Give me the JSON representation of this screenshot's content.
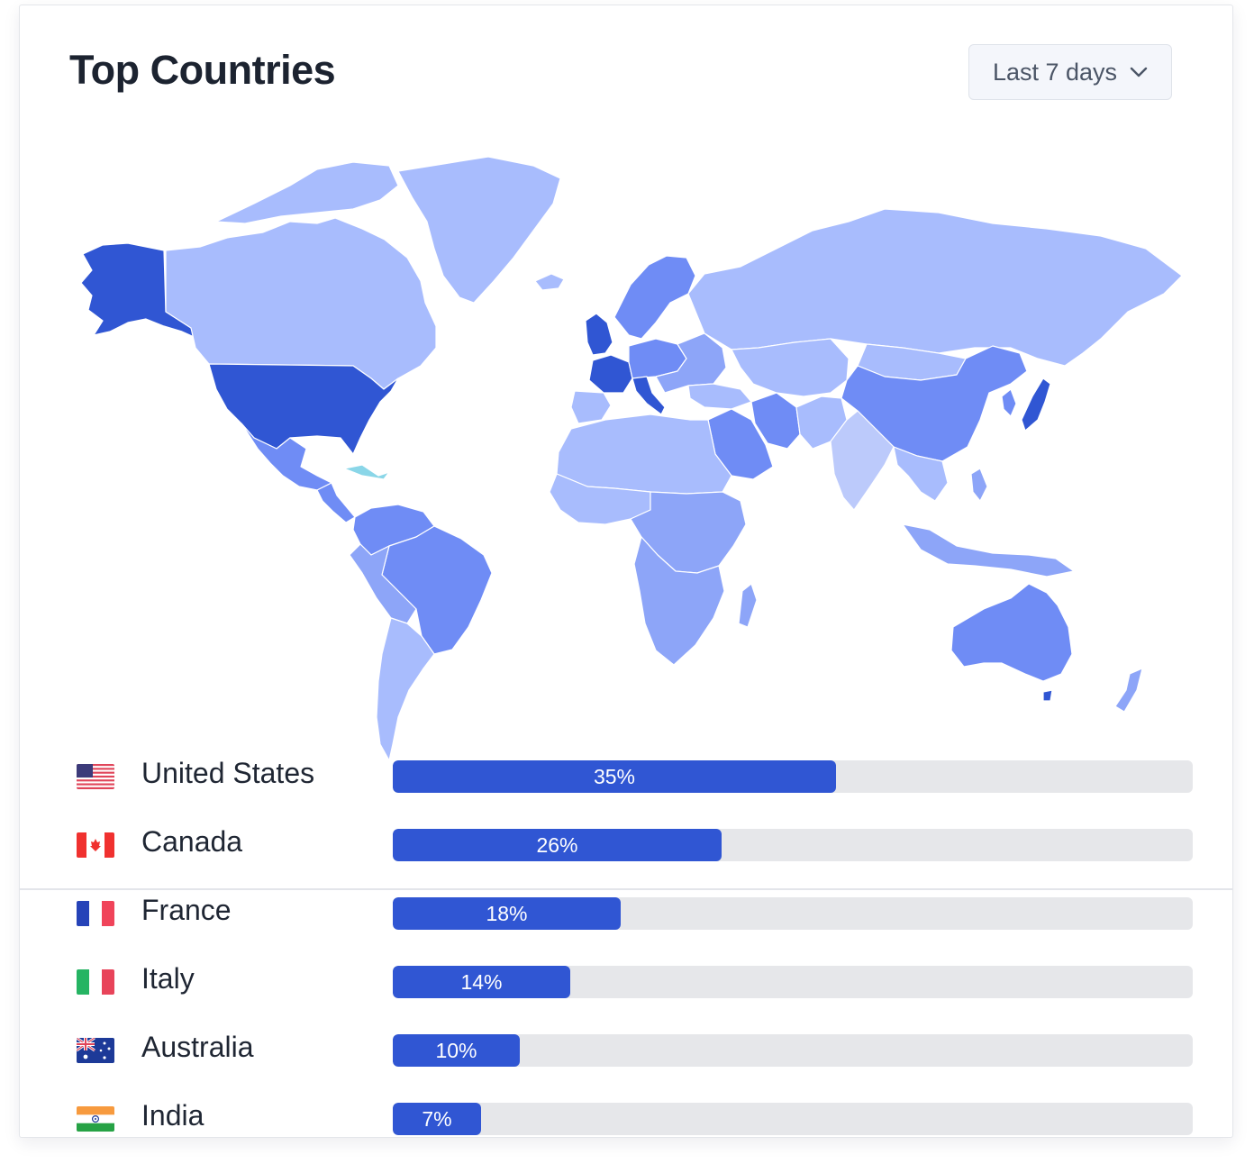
{
  "header": {
    "title": "Top Countries",
    "range_label": "Last 7 days"
  },
  "icons": {
    "dropdown": "chevron-down-icon"
  },
  "map_colors": {
    "highest": "#3056d3",
    "high": "#6f8cf5",
    "medium": "#8da5f8",
    "low": "#a8bcfd",
    "lowest": "#bccafb"
  },
  "countries": [
    {
      "name": "United States",
      "share": 35,
      "label": "35%",
      "flag": "us-flag-icon"
    },
    {
      "name": "Canada",
      "share": 26,
      "label": "26%",
      "flag": "ca-flag-icon"
    },
    {
      "name": "France",
      "share": 18,
      "label": "18%",
      "flag": "fr-flag-icon"
    },
    {
      "name": "Italy",
      "share": 14,
      "label": "14%",
      "flag": "it-flag-icon"
    },
    {
      "name": "Australia",
      "share": 10,
      "label": "10%",
      "flag": "au-flag-icon"
    },
    {
      "name": "India",
      "share": 7,
      "label": "7%",
      "flag": "in-flag-icon"
    }
  ],
  "bar_color": "#3056d3",
  "track_color": "#e6e7ea"
}
